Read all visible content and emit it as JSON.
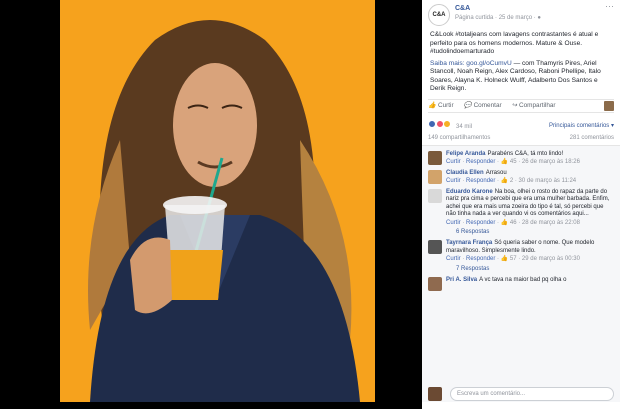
{
  "page": {
    "name": "C&A",
    "logo": "C&A",
    "meta": "Página curtida · 25 de março · ",
    "more": "···"
  },
  "post": {
    "p1": "C&Look #totaljeans com lavagens contrastantes é atual e perfeito para os homens modernos. Mature & Ouse. #tudolindoemarturado",
    "p2_link": "Saiba mais: goo.gl/oCumvU",
    "p2_rest": " — com Thamyris Pires, Ariel Stancoll, Noah Reign, Alex Cardoso, Raboni Phellipe, Italo Soares, Alayna K. Holneck Wulff, Adalberto Dos Santos e Derik Reign."
  },
  "actions": {
    "like": "Curtir",
    "comment": "Comentar",
    "share": "Compartilhar"
  },
  "reactions": {
    "count": "34 mil",
    "sort": "Principais comentários ▾",
    "shares": "149 compartilhamentos",
    "comments": "281 comentários"
  },
  "comments": [
    {
      "name": "Felipe Aranda",
      "text": "Parabéns C&A, tá mto lindo!",
      "actions": [
        "Curtir",
        "Responder"
      ],
      "likes": "45",
      "date": "26 de março às 18:26"
    },
    {
      "name": "Claudia Ellen",
      "text": "Arrasou",
      "actions": [
        "Curtir",
        "Responder"
      ],
      "likes": "2",
      "date": "30 de março às 11:24"
    },
    {
      "name": "Eduardo Karone",
      "text": "Na boa, olhei o rosto do rapaz da parte do nariz pra cima e percebi que era uma mulher barbada. Enfim, achei que era mais uma zoeira do tipo é tal, só percebi que não tinha nada a ver quando vi os comentários aqui...",
      "actions": [
        "Curtir",
        "Responder"
      ],
      "likes": "46",
      "date": "28 de março às 22:08",
      "replies": "6 Respostas"
    },
    {
      "name": "Tayrnara França",
      "text": "Só queria saber o nome. Que modelo maravilhoso. Simplesmente lindo.",
      "actions": [
        "Curtir",
        "Responder"
      ],
      "likes": "57",
      "date": "29 de março às 00:30",
      "replies": "7 Respostas"
    },
    {
      "name": "Pri A. Silva",
      "text": "A vc tava na maior bad pq olha o",
      "actions": [],
      "likes": "",
      "date": ""
    }
  ],
  "input": {
    "placeholder": "Escreva um comentário..."
  },
  "colors": {
    "photo_bg": "#f7a51c",
    "link": "#365899",
    "like": "#4267b2"
  }
}
